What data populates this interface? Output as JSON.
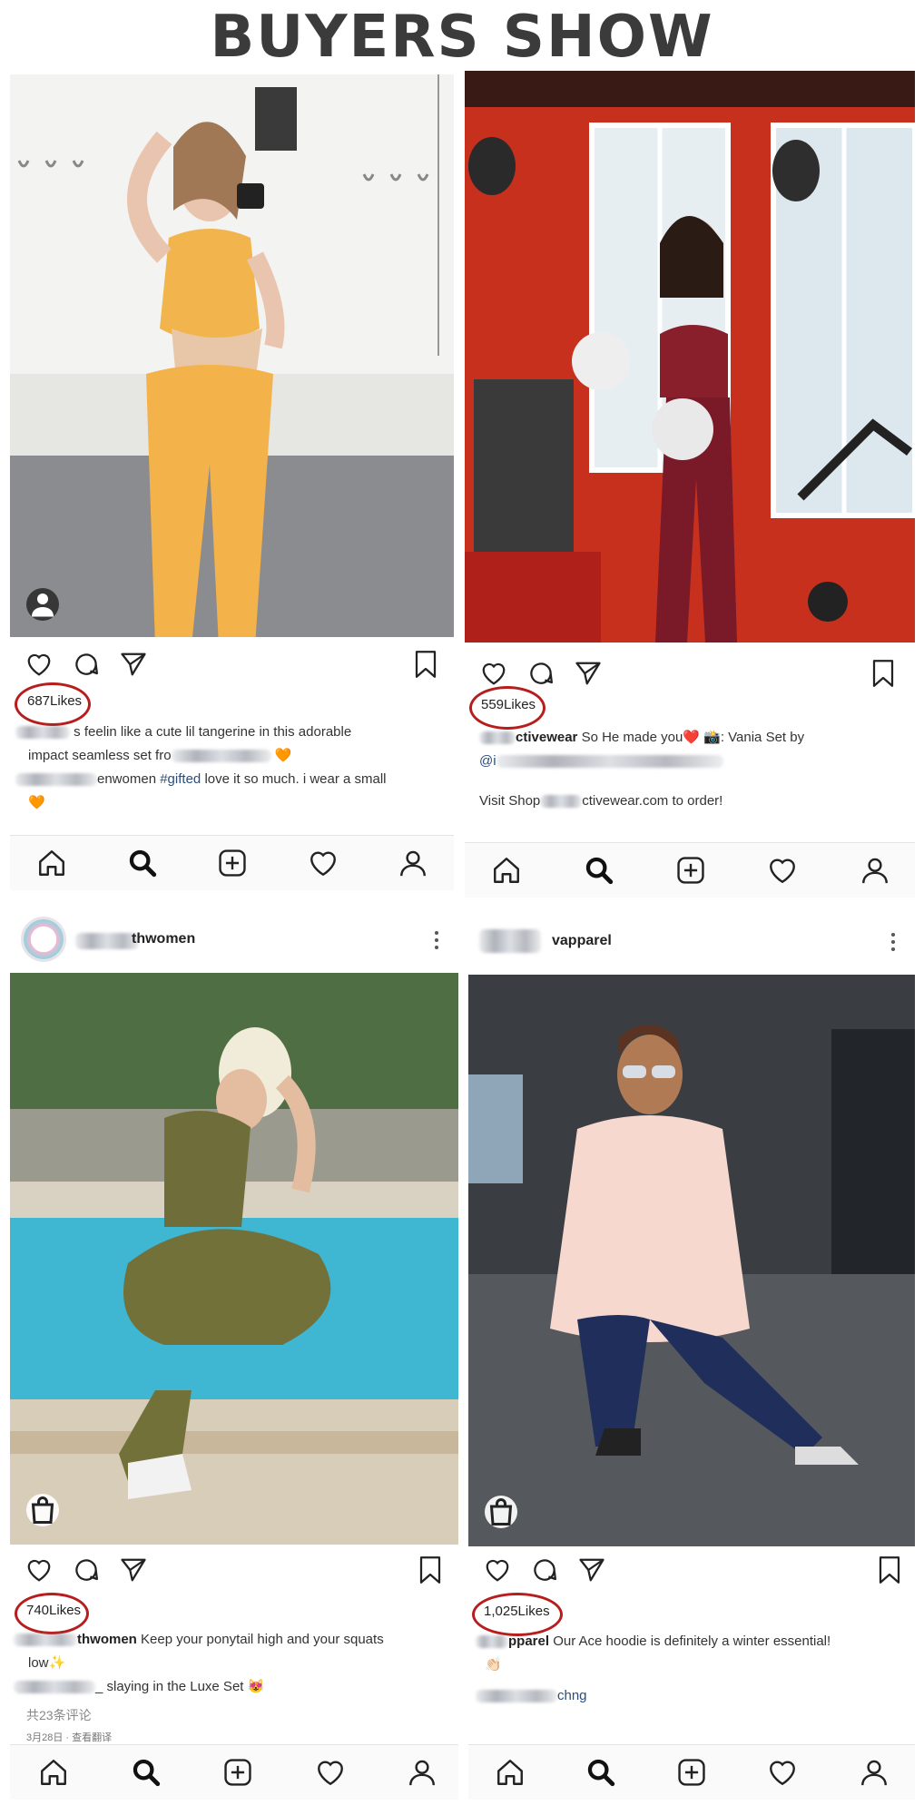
{
  "page": {
    "title": "BUYERS SHOW"
  },
  "posts": [
    {
      "likes_count": "687",
      "likes_label": "Likes",
      "caption_line1": "s feelin like a cute lil tangerine in this adorable",
      "caption_line2a": "impact seamless set fro",
      "caption_line2b": "🧡",
      "caption_line3a": "enwomen",
      "caption_line3tag": "#gifted",
      "caption_line3b": "love it so much. i wear a small",
      "caption_line4": "🧡",
      "icons": {
        "like": "heart-icon",
        "comment": "comment-icon",
        "share": "send-icon",
        "save": "bookmark-icon"
      }
    },
    {
      "likes_count": "559",
      "likes_label": "Likes",
      "caption_user": "ctivewear",
      "caption_line1": "So He made you❤️ 📸: Vania Set by",
      "caption_line2": "@i",
      "caption_line3a": "Visit Shop",
      "caption_line3b": "ctivewear.com to order!",
      "icons": {
        "like": "heart-icon",
        "comment": "comment-icon",
        "share": "send-icon",
        "save": "bookmark-icon"
      }
    },
    {
      "username": "thwomen",
      "likes_count": "740",
      "likes_label": "Likes",
      "caption_user": "thwomen",
      "caption_line1": "Keep your ponytail high and your squats",
      "caption_line2": "low✨",
      "caption_line3a": "_ slaying in",
      "caption_line3b": "the Luxe Set 😻",
      "comments": "共23条评论",
      "date": "3月28日 · 查看翻译",
      "icons": {
        "like": "heart-icon",
        "comment": "comment-icon",
        "share": "send-icon",
        "save": "bookmark-icon"
      }
    },
    {
      "username": "vapparel",
      "likes_count": "1,025",
      "likes_label": "Likes",
      "caption_user": "pparel",
      "caption_line1": "Our Ace hoodie is definitely a winter essential!",
      "caption_line2": "👏🏻",
      "caption_line3": "chng",
      "icons": {
        "like": "heart-icon",
        "comment": "comment-icon",
        "share": "send-icon",
        "save": "bookmark-icon"
      }
    }
  ],
  "tabbar": {
    "items": [
      "home-icon",
      "search-icon",
      "add-icon",
      "activity-icon",
      "profile-icon"
    ]
  },
  "colors": {
    "oval": "#b71d1d",
    "tag": "#2a4d7a"
  }
}
